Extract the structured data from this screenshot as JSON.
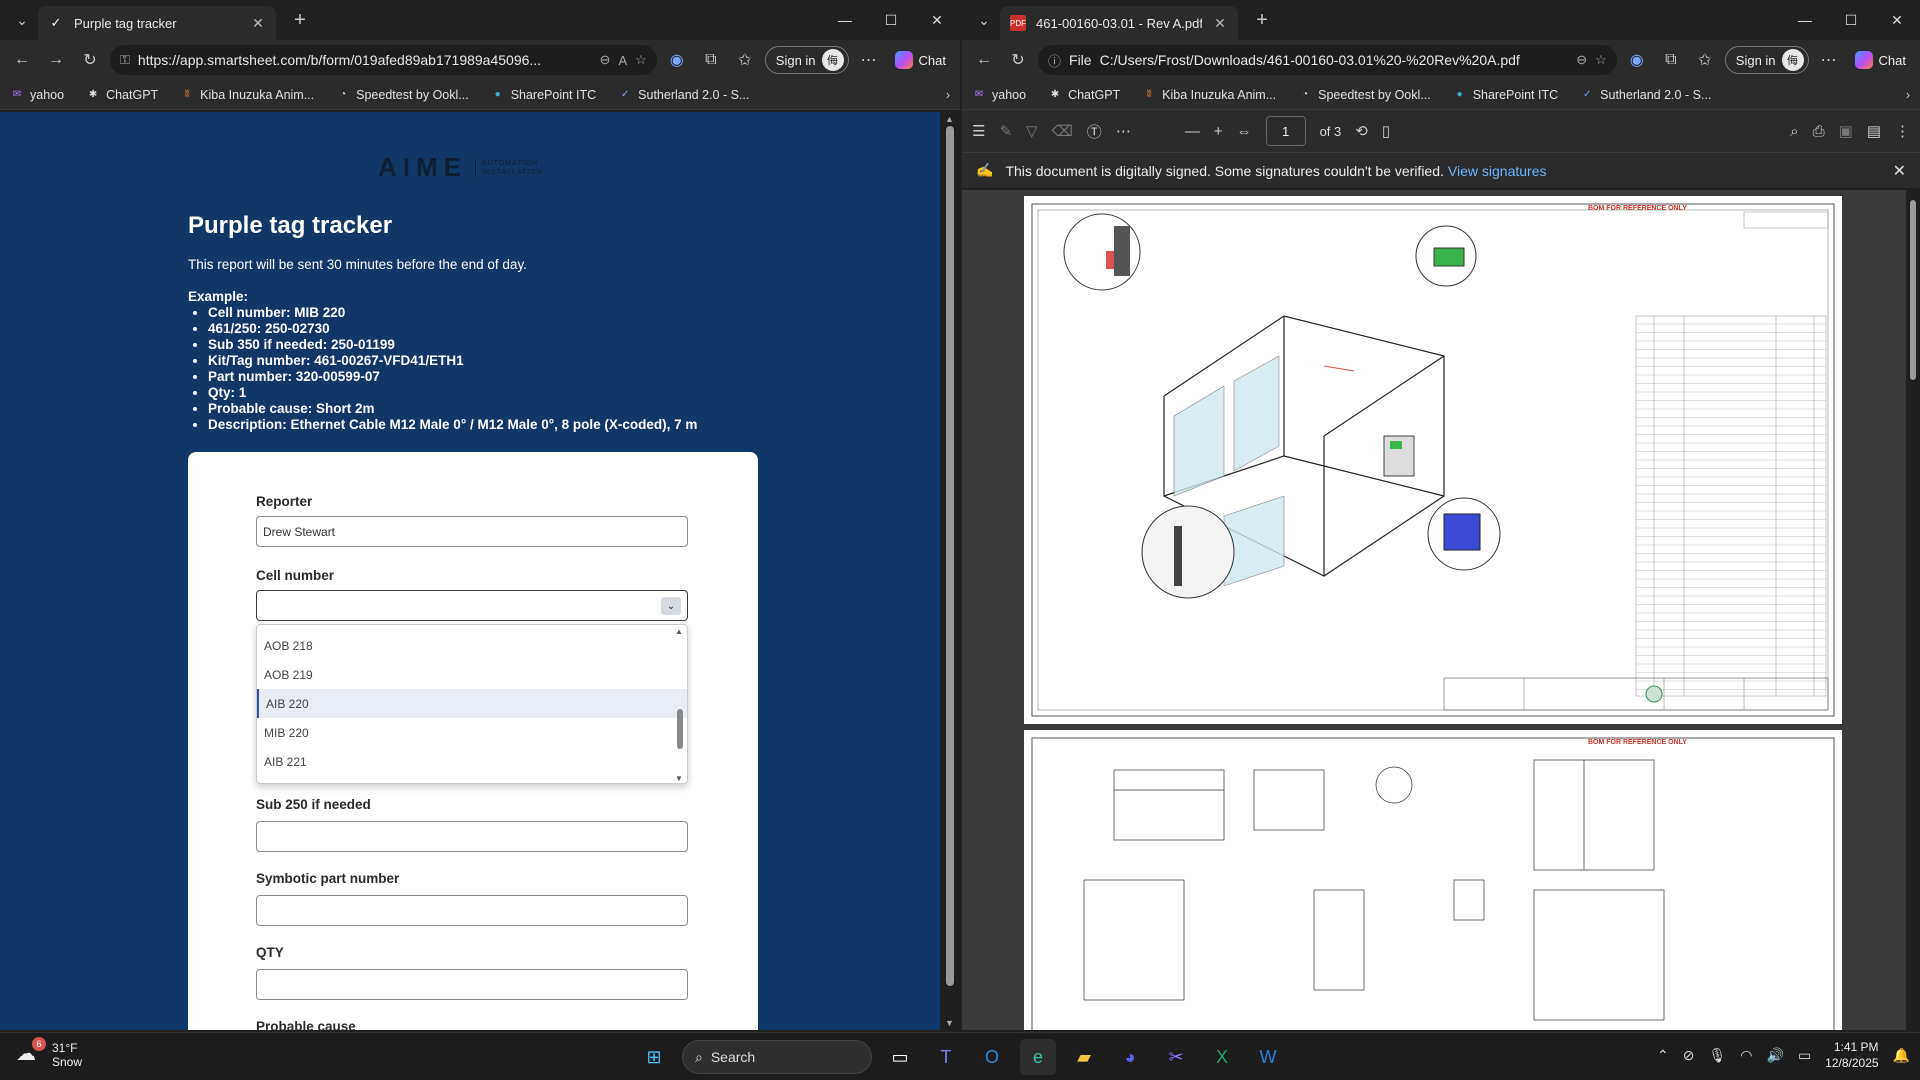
{
  "left": {
    "tab": {
      "title": "Purple tag tracker"
    },
    "url": "https://app.smartsheet.com/b/form/019afed89ab171989a45096...",
    "signin_label": "Sign in",
    "chat_label": "Chat",
    "favorites": [
      "yahoo",
      "ChatGPT",
      "Kiba Inuzuka Anim...",
      "Speedtest by Ookl...",
      "SharePoint ITC",
      "Sutherland 2.0 - S..."
    ],
    "logo_big": "AIME",
    "logo_small": "AUTOMATION INSTALLATION",
    "form": {
      "title": "Purple tag tracker",
      "description": "This report will be sent 30 minutes before the end of day.",
      "example_heading": "Example:",
      "example_items": [
        "Cell number: MIB 220",
        "461/250: 250-02730",
        "Sub 350 if needed: 250-01199",
        "Kit/Tag number: 461-00267-VFD41/ETH1",
        "Part number: 320-00599-07",
        "Qty: 1",
        "Probable cause: Short 2m",
        "Description: Ethernet Cable M12 Male 0° / M12 Male 0°, 8 pole (X-coded), 7 m"
      ],
      "reporter_label": "Reporter",
      "reporter_value": "Drew Stewart",
      "cell_label": "Cell number",
      "cell_options": [
        "AOB 218",
        "AOB 219",
        "AIB 220",
        "MIB 220",
        "AIB 221"
      ],
      "cell_highlighted": "AIB 220",
      "sub250_label": "Sub 250 if needed",
      "part_label": "Symbotic part number",
      "qty_label": "QTY",
      "cause_label": "Probable cause"
    }
  },
  "right": {
    "tab": {
      "title": "461-00160-03.01 - Rev A.pdf"
    },
    "file_label": "File",
    "url": "C:/Users/Frost/Downloads/461-00160-03.01%20-%20Rev%20A.pdf",
    "signin_label": "Sign in",
    "chat_label": "Chat",
    "favorites": [
      "yahoo",
      "ChatGPT",
      "Kiba Inuzuka Anim...",
      "Speedtest by Ookl...",
      "SharePoint ITC",
      "Sutherland 2.0 - S..."
    ],
    "page_current": "1",
    "page_total": "of 3",
    "sig_msg": "This document is digitally signed. Some signatures couldn't be verified.",
    "sig_link": "View signatures",
    "bom_note": "BOM FOR REFERENCE ONLY"
  },
  "taskbar": {
    "temp": "31°F",
    "cond": "Snow",
    "badge": "6",
    "search": "Search",
    "time": "1:41 PM",
    "date": "12/8/2025"
  }
}
